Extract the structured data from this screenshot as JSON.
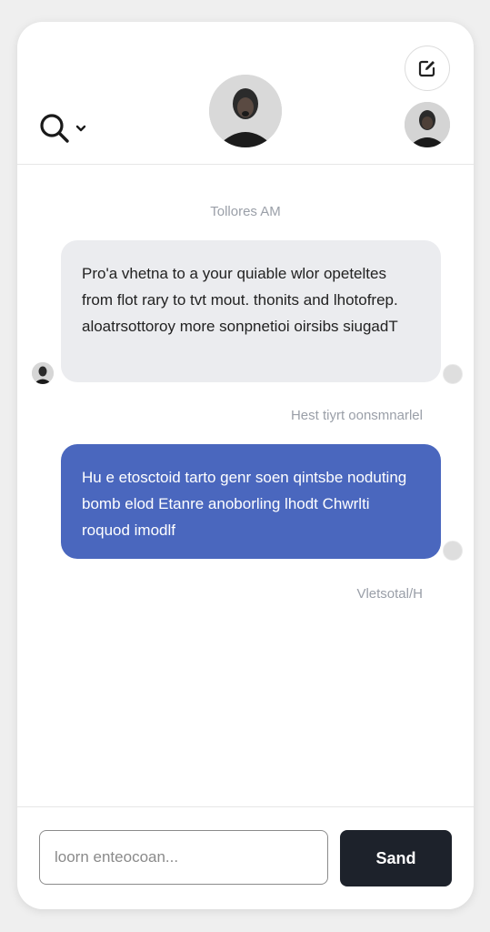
{
  "header": {
    "search_icon": "search-icon",
    "dropdown_icon": "chevron-down-icon",
    "compose_icon": "edit-icon"
  },
  "messages": [
    {
      "direction": "incoming",
      "text": "Pro'a vhetna to a your quiable wlor opeteltes from flot rary to tvt mout. thonits and lhotofrep. aloatrsottoroy more sonpnetioi oirsibs siugadT",
      "timestamp_above": "Tollores AM",
      "timestamp_below": "Hest tiyrt oonsmnarlel"
    },
    {
      "direction": "outgoing",
      "text": "Hu e etosctoid tarto genr soen qintsbe noduting bomb elod Etanre anoborling lhodt Chwrlti roquod imodlf",
      "timestamp_below": "Vletsotal/H"
    }
  ],
  "composer": {
    "placeholder": "loorn enteocoan...",
    "value": "",
    "send_label": "Sand"
  },
  "colors": {
    "accent": "#4a67be",
    "incoming_bubble": "#ebecef",
    "send_button": "#1d222b"
  }
}
